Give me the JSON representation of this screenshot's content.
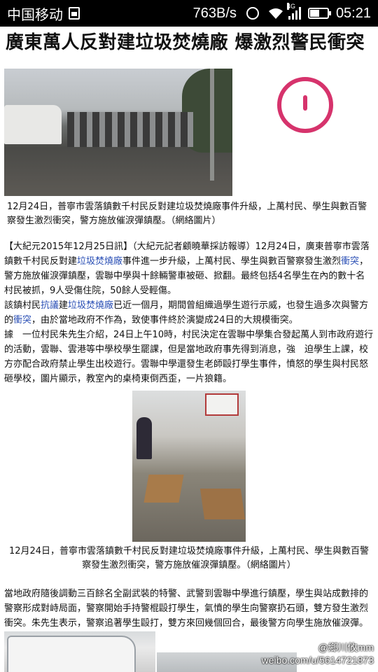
{
  "status_bar": {
    "carrier": "中国移动",
    "speed": "763B/s",
    "net_type": "4G",
    "time": "05:21",
    "icons": [
      "sim-icon",
      "alarm-icon",
      "wifi-icon",
      "signal-icon",
      "battery-icon"
    ]
  },
  "article": {
    "headline": "廣東萬人反對建垃圾焚燒廠 爆激烈警民衝突",
    "caption_1": "12月24日，普寧市雲落鎮數千村民反對建垃圾焚燒廠事件升級，上萬村民、學生與數百警察發生激烈衝突，警方施放催淚彈鎮壓。（網絡圖片）",
    "para_1": {
      "before": "【大紀元2015年12月25日訊】（大紀元記者顧曉華採訪報導）12月24日，廣東普寧市雲落鎮數千村民反對建",
      "link_1": "垃圾焚燒廠",
      "middle": "事件進一步升級，上萬村民、學生與數百警察發生激烈",
      "link_2": "衝突",
      "after": "，警方施放催淚彈鎮壓，雲聯中學與十餘輛警車被砸、掀翻。最終包括4名學生在內的數十名村民被抓，9人受傷住院，50餘人受輕傷。"
    },
    "para_2": {
      "before": "該鎮村民",
      "link_1": "抗議",
      "middle": "建",
      "link_2": "垃圾焚燒廠",
      "after_1": "已近一個月，期間曾組織過學生遊行示威，也發生過多次與警方的",
      "link_3": "衝突",
      "after_2": "，由於當地政府不作為，致使事件終於演變成24日的大規模衝突。"
    },
    "para_3": "據　一位村民朱先生介紹，24日上午10時，村民決定在雲聯中學集合發起萬人到市政府遊行的活動，雲聯、雲港等中學校學生罷課，但是當地政府事先得到消息，強　迫學生上課，校方亦配合政府禁止學生出校遊行。雲聯中學還發生老師毆打學生事件，憤怒的學生與村民怒砸學校，圖片顯示，教室內的桌椅東倒西歪，一片狼籍。",
    "caption_2": "12月24日，普寧市雲落鎮數千村民反對建垃圾焚燒廠事件升級，上萬村民、學生與數百警察發生激烈衝突，警方施放催淚彈鎮壓。（網絡圖片）",
    "para_4": "當地政府隨後調動三百餘名全副武裝的特警、武警到雲聯中學進行鎮壓，學生與站成數排的警察形成對峙局面，警察開始手持警棍毆打學生，氣憤的學生向警察扔石頭，雙方發生激烈衝突。朱先生表示，警察追著學生毆打，雙方來回幾個回合，最後警方向學生施放催淚彈。"
  },
  "watermark": {
    "handle": "@鄉川攸mm",
    "url": "weibo.com/u/5614721873"
  }
}
